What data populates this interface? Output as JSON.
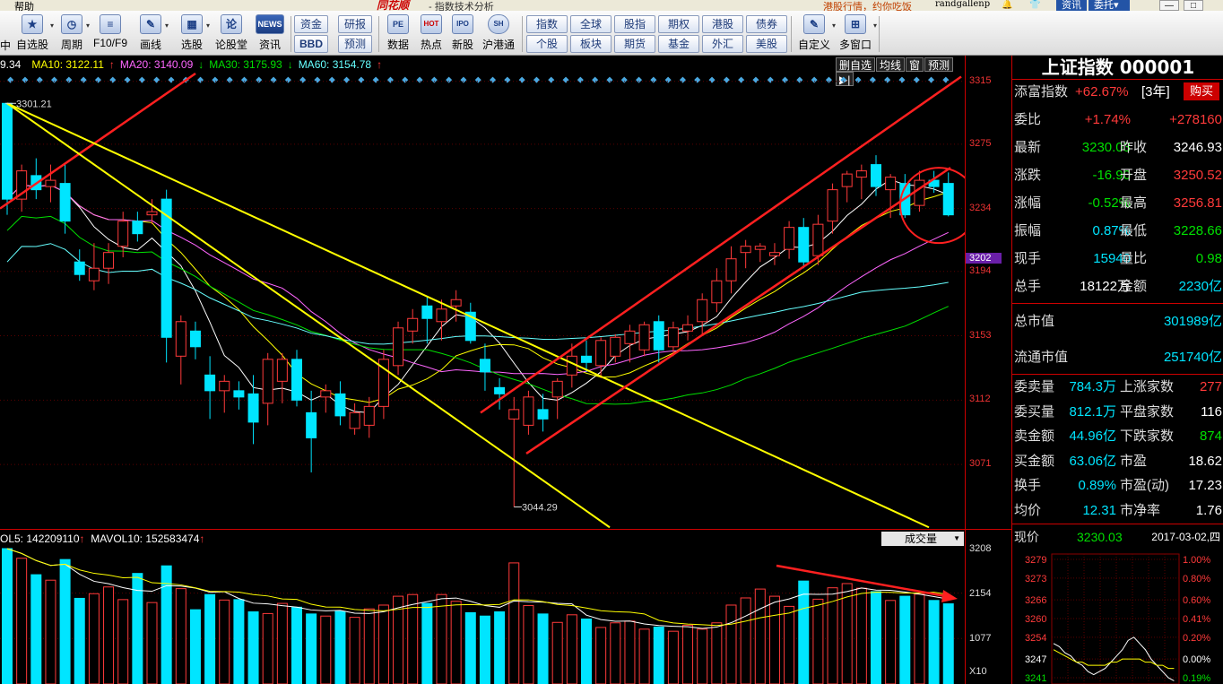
{
  "titlebar": {
    "menu": "帮助",
    "brand": "同花顺",
    "subtitle": "- 指数技术分析",
    "promo": "港股行情，约你吃饭",
    "user": "randgallenp",
    "news_tab": "资讯",
    "trade_tab": "委托",
    "trade_arrow": "▾",
    "icons": [
      "bell-icon",
      "shirt-icon"
    ],
    "window_buttons": [
      "—",
      "□"
    ]
  },
  "toolbar": {
    "tools": [
      {
        "label": "自选股",
        "icon": "★"
      },
      {
        "label": "周期",
        "icon": "◷"
      },
      {
        "label": "F10/F9",
        "icon": "≡"
      },
      {
        "label": "画线",
        "icon": "✎"
      },
      {
        "label": "选股",
        "icon": "▦"
      },
      {
        "label": "论股堂",
        "icon": "论"
      },
      {
        "label": "资讯",
        "icon": "NEWS"
      }
    ],
    "group1": {
      "top": [
        "资金",
        "研报"
      ],
      "bottom": [
        "BBD",
        "预测"
      ]
    },
    "tools2": [
      {
        "label": "数据",
        "icon": "PE"
      },
      {
        "label": "热点",
        "icon": "HOT"
      },
      {
        "label": "新股",
        "icon": "IPO"
      },
      {
        "label": "沪港通",
        "icon": "SH"
      }
    ],
    "group2": {
      "top": [
        "指数",
        "全球",
        "股指",
        "期权",
        "港股",
        "债券"
      ],
      "bottom": [
        "个股",
        "板块",
        "期货",
        "基金",
        "外汇",
        "美股"
      ]
    },
    "tools3": [
      {
        "label": "自定义",
        "icon": "✎"
      },
      {
        "label": "多窗口",
        "icon": "⊞"
      }
    ]
  },
  "mainchart": {
    "ma": [
      {
        "text": "9.34",
        "color": "#ffffff"
      },
      {
        "text": "MA10: 3122.11",
        "color": "#ffff00",
        "arrow": "↑",
        "arrow_color": "#ff3a3a"
      },
      {
        "text": "MA20: 3140.09",
        "color": "#ff66ff",
        "arrow": "↓",
        "arrow_color": "#00e000"
      },
      {
        "text": "MA30: 3175.93",
        "color": "#00e000",
        "arrow": "↓",
        "arrow_color": "#00e000"
      },
      {
        "text": "MA60: 3154.78",
        "color": "#66ffff",
        "arrow": "↑",
        "arrow_color": "#ff3a3a"
      }
    ],
    "buttons": [
      "删自选",
      "均线",
      "窗",
      "预测",
      "▶|"
    ],
    "high_label": "3301.21",
    "low_label": "3044.29",
    "price_axis": [
      "3315",
      "3275",
      "3234",
      "3202",
      "3194",
      "3153",
      "3112",
      "3071"
    ],
    "current_price_tag": "3202"
  },
  "volume": {
    "vol5": "OL5: 142209110",
    "vol5_arrow": "↑",
    "mavol10": "MAVOL10: 152583474",
    "mavol10_arrow": "↑",
    "selector": "成交量",
    "axis": [
      "3208",
      "2154",
      "1077"
    ],
    "unit": "X10"
  },
  "panel": {
    "title": "上证指数 000001",
    "rows": [
      {
        "k": "添富指数",
        "v1": "+62.67%",
        "v1c": "red",
        "v2": "[3年]"
      },
      {
        "k": "委比",
        "v1": "+1.74%",
        "v1c": "red",
        "k2": "",
        "v2": "+278160",
        "v2c": "red"
      },
      {
        "k": "最新",
        "v1": "3230.03",
        "v1c": "green",
        "k2": "昨收",
        "v2": "3246.93",
        "v2c": "white"
      },
      {
        "k": "涨跌",
        "v1": "-16.90",
        "v1c": "green",
        "k2": "开盘",
        "v2": "3250.52",
        "v2c": "red"
      },
      {
        "k": "涨幅",
        "v1": "-0.52%",
        "v1c": "green",
        "k2": "最高",
        "v2": "3256.81",
        "v2c": "red"
      },
      {
        "k": "振幅",
        "v1": "0.87%",
        "v1c": "cyan",
        "k2": "最低",
        "v2": "3228.66",
        "v2c": "green"
      },
      {
        "k": "现手",
        "v1": "15940",
        "v1c": "cyan",
        "k2": "量比",
        "v2": "0.98",
        "v2c": "green"
      },
      {
        "k": "总手",
        "v1": "18122万",
        "v1c": "white",
        "k2": "金额",
        "v2": "2230亿",
        "v2c": "cyan"
      }
    ],
    "buy": "购买",
    "cap": [
      {
        "k": "总市值",
        "v": "301989亿"
      },
      {
        "k": "流通市值",
        "v": "251740亿"
      }
    ],
    "rows2": [
      {
        "k": "委卖量",
        "v1": "784.3万",
        "k2": "上涨家数",
        "v2": "277",
        "v2c": "red"
      },
      {
        "k": "委买量",
        "v1": "812.1万",
        "k2": "平盘家数",
        "v2": "116",
        "v2c": "white"
      },
      {
        "k": "卖金额",
        "v1": "44.96亿",
        "k2": "下跌家数",
        "v2": "874",
        "v2c": "green"
      },
      {
        "k": "买金额",
        "v1": "63.06亿",
        "k2": "市盈",
        "v2": "18.62",
        "v2c": "white"
      },
      {
        "k": "换手",
        "v1": "0.89%",
        "k2": "市盈(动)",
        "v2": "17.23",
        "v2c": "white"
      },
      {
        "k": "均价",
        "v1": "12.31",
        "k2": "市净率",
        "v2": "1.76",
        "v2c": "white"
      }
    ],
    "now_label": "现价",
    "now_value": "3230.03",
    "now_date": "2017-03-02,四",
    "mini_left": [
      "3279",
      "3273",
      "3266",
      "3260",
      "3254",
      "3247",
      "3241"
    ],
    "mini_right": [
      "1.00%",
      "0.80%",
      "0.60%",
      "0.41%",
      "0.20%",
      "0.00%",
      "0.19%"
    ]
  },
  "chart_data": {
    "type": "candlestick",
    "candles": [
      [
        3301,
        3301,
        3230,
        3240,
        0
      ],
      [
        3240,
        3262,
        3232,
        3258,
        1
      ],
      [
        3255,
        3266,
        3240,
        3246,
        0
      ],
      [
        3248,
        3262,
        3238,
        3252,
        1
      ],
      [
        3250,
        3262,
        3218,
        3226,
        0
      ],
      [
        3200,
        3208,
        3188,
        3192,
        0
      ],
      [
        3188,
        3212,
        3182,
        3196,
        1
      ],
      [
        3196,
        3212,
        3186,
        3206,
        1
      ],
      [
        3210,
        3232,
        3203,
        3226,
        1
      ],
      [
        3226,
        3232,
        3213,
        3218,
        0
      ],
      [
        3232,
        3240,
        3224,
        3230,
        1
      ],
      [
        3240,
        3246,
        3136,
        3152,
        0
      ],
      [
        3140,
        3166,
        3122,
        3162,
        1
      ],
      [
        3156,
        3162,
        3138,
        3146,
        0
      ],
      [
        3128,
        3140,
        3100,
        3118,
        0
      ],
      [
        3118,
        3128,
        3104,
        3124,
        1
      ],
      [
        3118,
        3124,
        3106,
        3114,
        0
      ],
      [
        3116,
        3128,
        3084,
        3098,
        0
      ],
      [
        3110,
        3142,
        3096,
        3138,
        1
      ],
      [
        3138,
        3142,
        3110,
        3124,
        1
      ],
      [
        3138,
        3144,
        3108,
        3112,
        0
      ],
      [
        3104,
        3118,
        3066,
        3088,
        0
      ],
      [
        3114,
        3122,
        3104,
        3118,
        1
      ],
      [
        3116,
        3124,
        3096,
        3102,
        0
      ],
      [
        3094,
        3110,
        3090,
        3104,
        1
      ],
      [
        3096,
        3114,
        3088,
        3108,
        1
      ],
      [
        3108,
        3144,
        3100,
        3138,
        1
      ],
      [
        3134,
        3162,
        3128,
        3158,
        1
      ],
      [
        3156,
        3170,
        3148,
        3164,
        1
      ],
      [
        3172,
        3178,
        3148,
        3164,
        0
      ],
      [
        3162,
        3176,
        3150,
        3170,
        1
      ],
      [
        3172,
        3182,
        3162,
        3176,
        1
      ],
      [
        3168,
        3174,
        3148,
        3150,
        0
      ],
      [
        3138,
        3148,
        3118,
        3130,
        0
      ],
      [
        3120,
        3126,
        3106,
        3116,
        0
      ],
      [
        3100,
        3114,
        3044,
        3106,
        1
      ],
      [
        3096,
        3118,
        3090,
        3114,
        1
      ],
      [
        3106,
        3116,
        3092,
        3100,
        0
      ],
      [
        3114,
        3126,
        3100,
        3124,
        1
      ],
      [
        3128,
        3148,
        3120,
        3140,
        1
      ],
      [
        3140,
        3150,
        3130,
        3136,
        0
      ],
      [
        3134,
        3152,
        3126,
        3150,
        1
      ],
      [
        3140,
        3154,
        3136,
        3152,
        1
      ],
      [
        3148,
        3160,
        3136,
        3156,
        1
      ],
      [
        3144,
        3162,
        3140,
        3160,
        1
      ],
      [
        3162,
        3166,
        3136,
        3144,
        0
      ],
      [
        3146,
        3162,
        3140,
        3158,
        1
      ],
      [
        3156,
        3166,
        3150,
        3160,
        1
      ],
      [
        3162,
        3180,
        3154,
        3176,
        1
      ],
      [
        3174,
        3196,
        3168,
        3188,
        1
      ],
      [
        3188,
        3210,
        3180,
        3202,
        1
      ],
      [
        3206,
        3214,
        3196,
        3210,
        1
      ],
      [
        3210,
        3212,
        3200,
        3208,
        1
      ],
      [
        3204,
        3212,
        3198,
        3206,
        1
      ],
      [
        3208,
        3226,
        3202,
        3222,
        1
      ],
      [
        3222,
        3228,
        3196,
        3200,
        0
      ],
      [
        3204,
        3230,
        3198,
        3224,
        1
      ],
      [
        3226,
        3250,
        3218,
        3246,
        1
      ],
      [
        3248,
        3258,
        3238,
        3256,
        1
      ],
      [
        3254,
        3262,
        3240,
        3258,
        1
      ],
      [
        3262,
        3268,
        3242,
        3248,
        0
      ],
      [
        3246,
        3256,
        3228,
        3254,
        1
      ],
      [
        3250,
        3256,
        3228,
        3230,
        0
      ],
      [
        3236,
        3258,
        3232,
        3252,
        1
      ],
      [
        3252,
        3258,
        3244,
        3248,
        0
      ],
      [
        3250,
        3257,
        3229,
        3230,
        0
      ]
    ],
    "volumes": [
      3208,
      2980,
      2590,
      2460,
      2950,
      2030,
      2140,
      2300,
      2000,
      2620,
      1930,
      2800,
      2260,
      1760,
      2120,
      1990,
      2000,
      1710,
      1670,
      1910,
      1820,
      1660,
      1610,
      1720,
      1580,
      1780,
      1870,
      2080,
      2120,
      1910,
      2120,
      1960,
      1690,
      1610,
      1710,
      2870,
      1860,
      1660,
      1460,
      1640,
      1540,
      1340,
      1450,
      1490,
      1300,
      1350,
      1250,
      1390,
      1300,
      1450,
      1870,
      2040,
      2250,
      2080,
      1840,
      2440,
      2010,
      2280,
      2380,
      2270,
      2190,
      1980,
      2080,
      2130,
      1980,
      1900
    ],
    "price_range": [
      3030,
      3320
    ],
    "volume_range": [
      0,
      3208
    ],
    "mini_ticks": {
      "left_range": [
        3241,
        3279
      ],
      "right_range": [
        -0.19,
        1.0
      ]
    }
  }
}
